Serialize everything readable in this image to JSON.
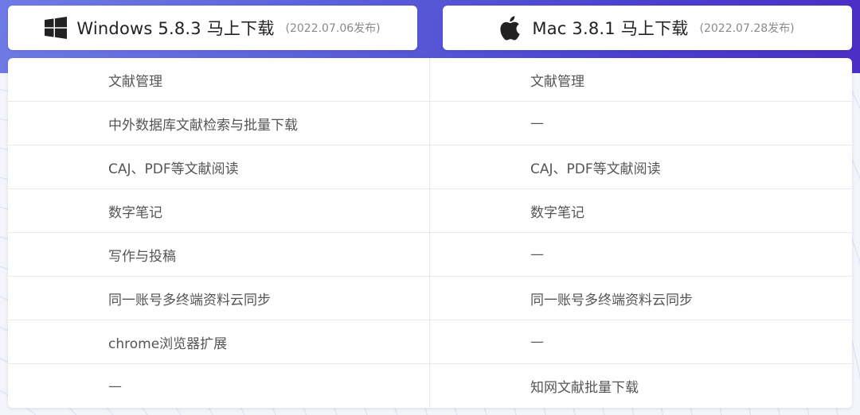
{
  "downloads": {
    "windows": {
      "label": "Windows 5.8.3 马上下载",
      "date": "(2022.07.06发布)",
      "icon": "windows-logo-icon"
    },
    "mac": {
      "label": "Mac 3.8.1 马上下载",
      "date": "(2022.07.28发布)",
      "icon": "apple-logo-icon"
    }
  },
  "features": {
    "rows": [
      {
        "windows": "文献管理",
        "mac": "文献管理"
      },
      {
        "windows": "中外数据库文献检索与批量下载",
        "mac": "—"
      },
      {
        "windows": "CAJ、PDF等文献阅读",
        "mac": "CAJ、PDF等文献阅读"
      },
      {
        "windows": "数字笔记",
        "mac": "数字笔记"
      },
      {
        "windows": "写作与投稿",
        "mac": "—"
      },
      {
        "windows": "同一账号多终端资料云同步",
        "mac": "同一账号多终端资料云同步"
      },
      {
        "windows": "chrome浏览器扩展",
        "mac": "—"
      },
      {
        "windows": "—",
        "mac": "知网文献批量下载"
      }
    ]
  },
  "colors": {
    "accent_gradient_start": "#6f7ae6",
    "accent_gradient_end": "#4b2fc4"
  }
}
